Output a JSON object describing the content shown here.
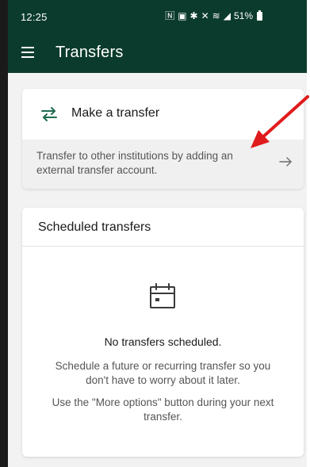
{
  "status_bar": {
    "time": "12:25",
    "icons": [
      "nfc-icon",
      "vibrate-icon",
      "bluetooth-icon",
      "mute-icon",
      "wifi-icon",
      "signal-icon"
    ],
    "battery": "51%"
  },
  "app_bar": {
    "title": "Transfers",
    "menu_icon": "hamburger-menu-icon"
  },
  "make_transfer": {
    "icon": "swap-arrows-icon",
    "label": "Make a transfer",
    "description": "Transfer to other institutions by adding an external transfer account.",
    "action_icon": "arrow-right-icon"
  },
  "scheduled": {
    "title": "Scheduled transfers",
    "empty_icon": "calendar-icon",
    "empty_title": "No transfers scheduled.",
    "empty_desc": "Schedule a future or recurring transfer so you don't have to worry about it later.",
    "empty_hint": "Use the \"More options\" button during your next transfer."
  },
  "colors": {
    "header": "#0b3b2c",
    "accent": "#1f6b4e",
    "annotation": "#e01b1b"
  }
}
